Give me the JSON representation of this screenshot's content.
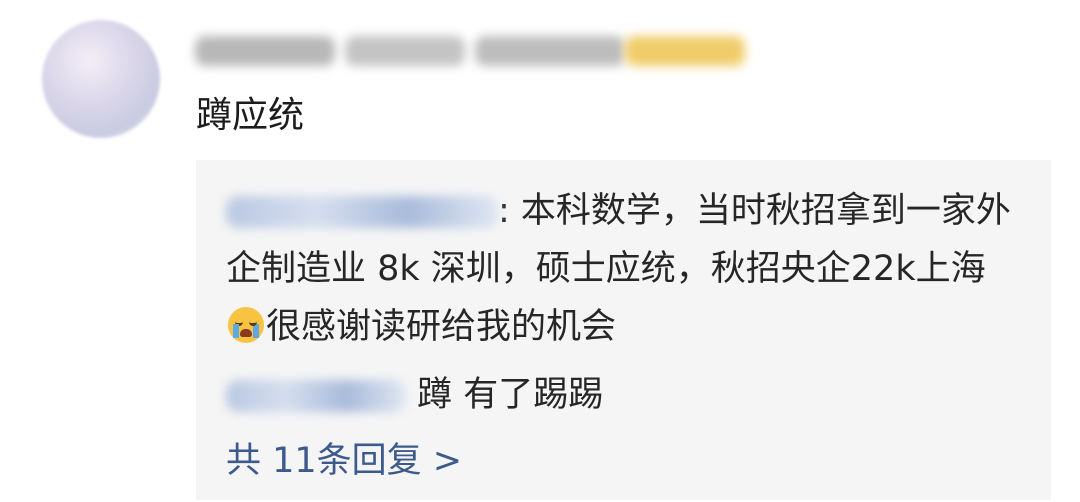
{
  "comment": {
    "text": "蹲应统"
  },
  "replies": [
    {
      "text": ": 本科数学，当时秋招拿到一家外企制造业 8k 深圳，硕士应统，秋招央企22k上海",
      "text_after_emoji": "很感谢读研给我的机会",
      "emoji": "loudly-crying-face"
    },
    {
      "text": "蹲 有了踢踢"
    }
  ],
  "more_replies_label": "共 11条回复 >",
  "colors": {
    "reply_box_bg": "#f5f5f5",
    "link": "#3d5a8c",
    "text": "#262626"
  }
}
